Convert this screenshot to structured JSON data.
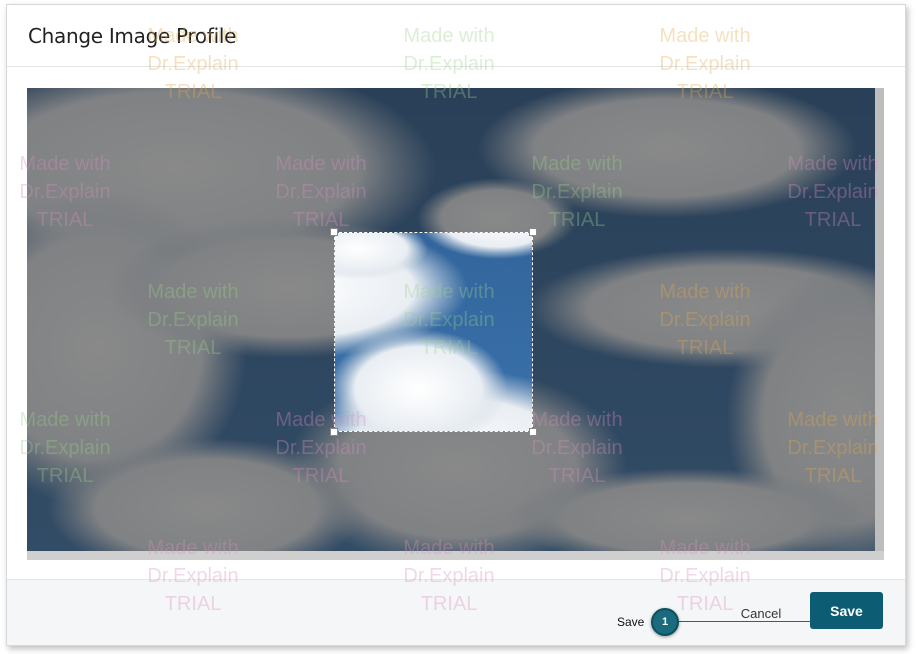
{
  "dialog": {
    "title": "Change Image Profile"
  },
  "footer": {
    "cancel_label": "Cancel",
    "save_label": "Save"
  },
  "callout": {
    "number": "1",
    "label": "Save"
  },
  "watermark": {
    "line1": "Made with",
    "line2": "Dr.Explain",
    "line3": "TRIAL"
  },
  "colors": {
    "primary": "#0c5d74",
    "callout": "#1a6b7e"
  }
}
